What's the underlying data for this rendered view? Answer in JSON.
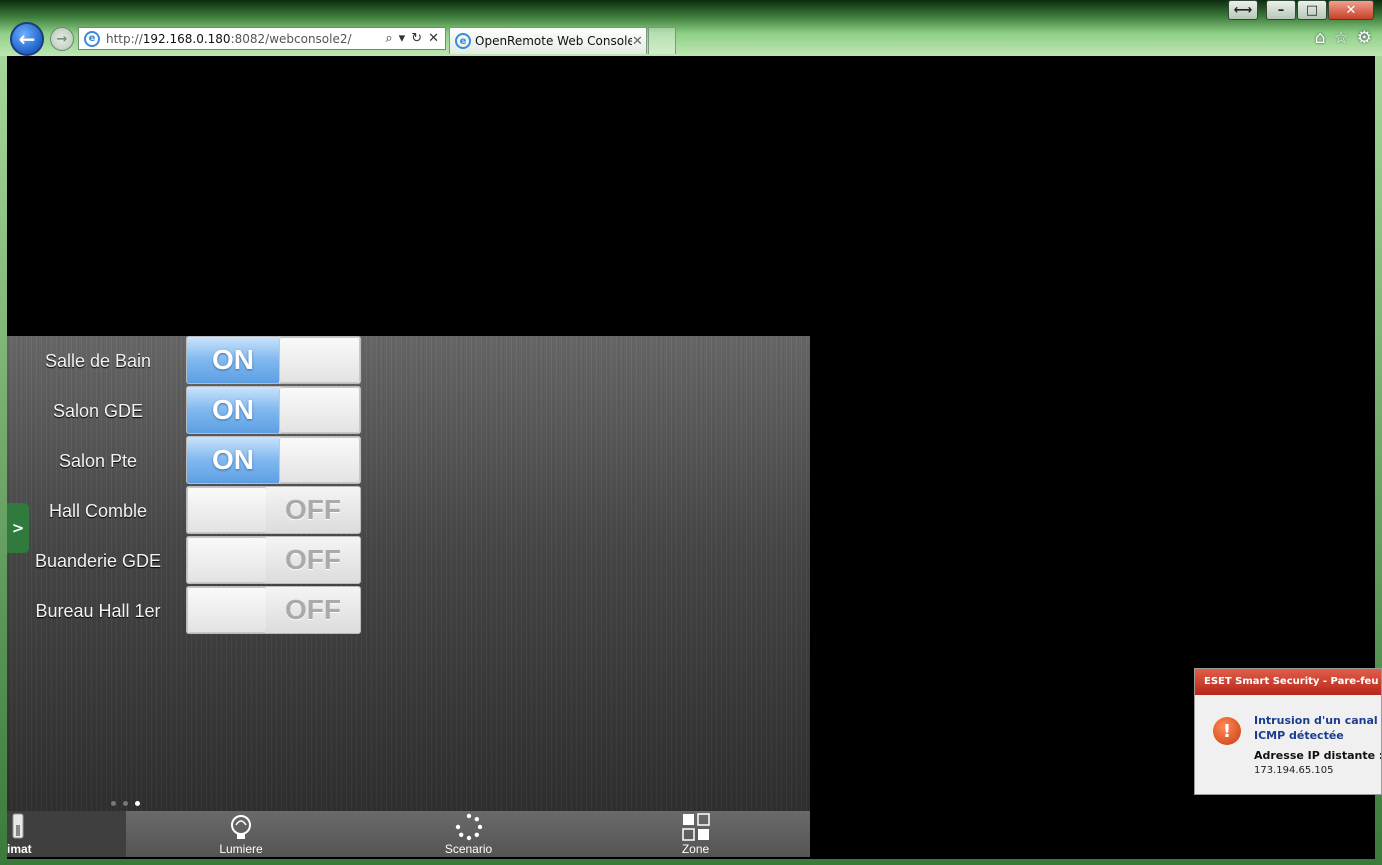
{
  "browser": {
    "address": {
      "scheme": "http://",
      "host": "192.168.0.180",
      "rest": ":8082/webconsole2/"
    },
    "tab_title": "OpenRemote Web Console ...",
    "icons": [
      "back-icon",
      "forward-icon",
      "search-icon",
      "refresh-icon",
      "stop-icon",
      "home-icon",
      "favorites-icon",
      "settings-icon"
    ]
  },
  "switches": [
    {
      "label": "Salle de Bain",
      "state": "on",
      "state_label": "ON"
    },
    {
      "label": "Salon GDE",
      "state": "on",
      "state_label": "ON"
    },
    {
      "label": "Salon Pte",
      "state": "on",
      "state_label": "ON"
    },
    {
      "label": "Hall Comble",
      "state": "off",
      "state_label": "OFF"
    },
    {
      "label": "Buanderie GDE",
      "state": "off",
      "state_label": "OFF"
    },
    {
      "label": "Bureau Hall 1er",
      "state": "off",
      "state_label": "OFF"
    }
  ],
  "side_handle": ">",
  "pager": {
    "count": 3,
    "active": 3
  },
  "tabbar": [
    {
      "label": "imat",
      "icon": "thermometer-icon",
      "selected": true
    },
    {
      "label": "Lumiere",
      "icon": "light-bulb-icon",
      "selected": false
    },
    {
      "label": "Scenario",
      "icon": "loading-circle-icon",
      "selected": false
    },
    {
      "label": "Zone",
      "icon": "grid-icon",
      "selected": false
    }
  ],
  "eset": {
    "header": "ESET Smart Security - Pare-feu personnel",
    "title_line1": "Intrusion d'un canal dissimulé",
    "title_line2": "ICMP détectée",
    "ip_label": "Adresse IP distante :",
    "ip": "173.194.65.105"
  },
  "colors": {
    "on_blue": "#6aa8ea",
    "eset_red": "#c8321f",
    "handle_green": "#2f7a3c"
  }
}
